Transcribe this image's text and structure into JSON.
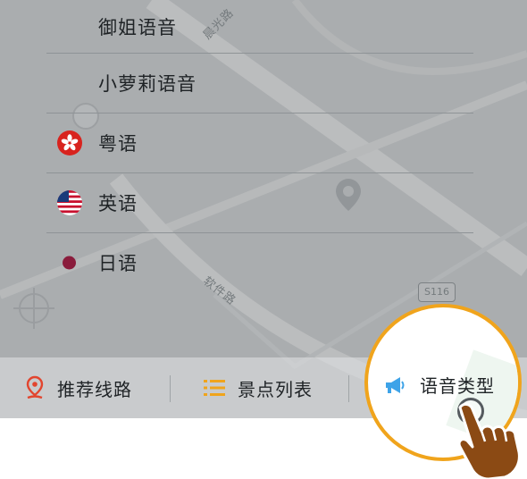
{
  "map": {
    "road_labels": [
      "晨光路",
      "软件路"
    ],
    "highway_badge": "S116"
  },
  "voice_list": {
    "items": [
      {
        "label": "御姐语音",
        "icon": "none"
      },
      {
        "label": "小萝莉语音",
        "icon": "none"
      },
      {
        "label": "粤语",
        "icon": "hong-kong-flag-icon"
      },
      {
        "label": "英语",
        "icon": "us-flag-icon"
      },
      {
        "label": "日语",
        "icon": "japan-dot-icon"
      }
    ]
  },
  "tabbar": {
    "tabs": [
      {
        "label": "推荐线路",
        "icon": "route-pin-icon"
      },
      {
        "label": "景点列表",
        "icon": "list-icon"
      },
      {
        "label": "语音类型",
        "icon": "megaphone-icon",
        "highlighted": true
      }
    ]
  },
  "colors": {
    "accent_orange": "#f0a41c",
    "megaphone_blue": "#3ea3e8",
    "japan_dot": "#8a1c3c",
    "hk_red": "#d8231e"
  }
}
